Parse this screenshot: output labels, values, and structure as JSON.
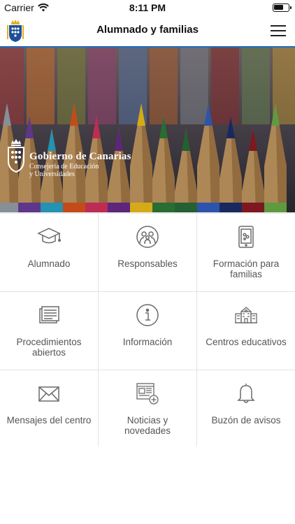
{
  "status_bar": {
    "carrier": "Carrier",
    "time": "8:11 PM"
  },
  "nav": {
    "title": "Alumnado y familias",
    "logo_icon": "coat-of-arms-icon",
    "menu_icon": "hamburger-menu-icon"
  },
  "hero": {
    "brand_name": "Gobierno de Canarias",
    "brand_sub_line1": "Consejería de Educación",
    "brand_sub_line2": "y Universidades",
    "pencil_colors": [
      "#9aa3ad",
      "#6b3f9e",
      "#2aa7c9",
      "#e0561d",
      "#d8345f",
      "#6a2c8c",
      "#f3c21c",
      "#2f7d3a",
      "#2a6e3a",
      "#355fc4",
      "#1d2f6d",
      "#8f1c25",
      "#6db04a"
    ]
  },
  "tiles": [
    {
      "label": "Alumnado",
      "icon": "graduation-cap-icon"
    },
    {
      "label": "Responsables",
      "icon": "family-icon"
    },
    {
      "label": "Formación para familias",
      "icon": "tablet-icon"
    },
    {
      "label": "Procedimientos abiertos",
      "icon": "document-stack-icon"
    },
    {
      "label": "Información",
      "icon": "info-icon"
    },
    {
      "label": "Centros educativos",
      "icon": "school-building-icon"
    },
    {
      "label": "Mensajes del centro",
      "icon": "envelope-icon"
    },
    {
      "label": "Noticias y novedades",
      "icon": "news-add-icon"
    },
    {
      "label": "Buzón de avisos",
      "icon": "bell-icon"
    }
  ]
}
